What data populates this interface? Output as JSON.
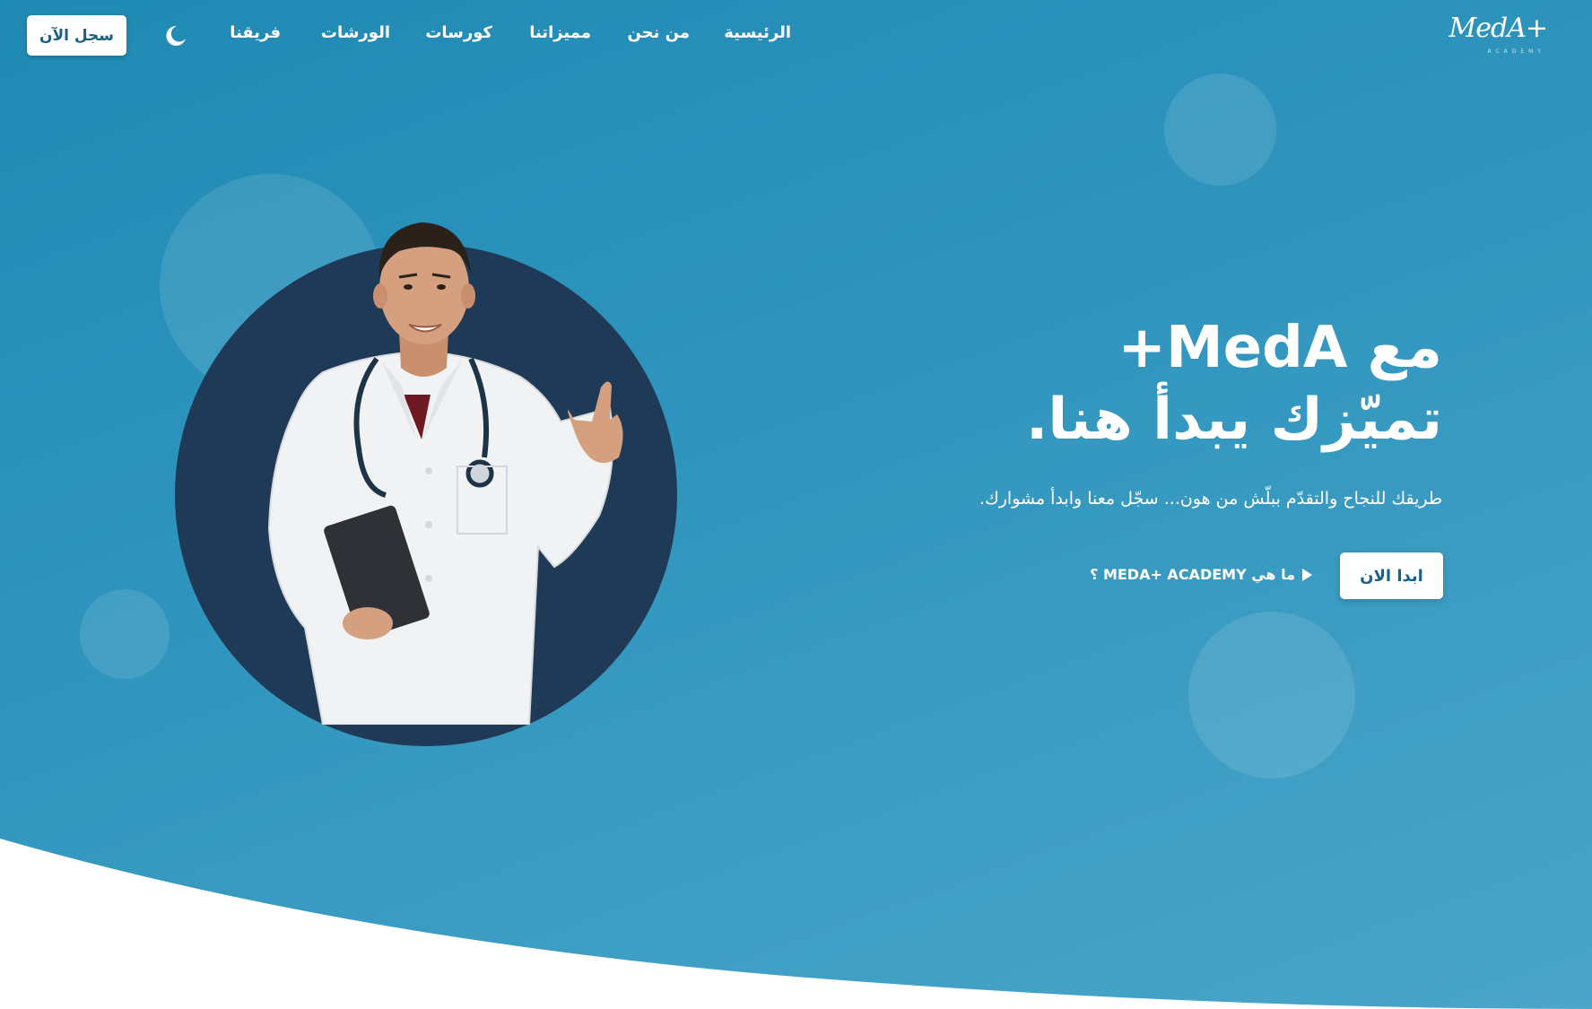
{
  "brand": {
    "logo_text": "MedA+",
    "logo_sub": "ACADEMY"
  },
  "nav": {
    "links": [
      {
        "label": "الرئيسية"
      },
      {
        "label": "من نحن"
      },
      {
        "label": "مميزاتنا"
      },
      {
        "label": "كورسات"
      },
      {
        "label": "الورشات"
      },
      {
        "label": "فريقنا"
      }
    ],
    "theme_toggle_icon": "moon-icon",
    "register_label": "سجل الآن"
  },
  "hero": {
    "title_line1": "مع MedA+",
    "title_line2": "تميّزك يبدأ هنا.",
    "subtitle": "طريقك للنجاح والتقدّم ببلّش من هون... سجّل معنا وابدأ مشوارك.",
    "start_label": "ابدا الان",
    "what_label": "ما هي MEDA+ ACADEMY ؟",
    "what_icon": "play-icon"
  },
  "colors": {
    "background": "#2a91bb",
    "circle": "#1e3a56",
    "button_text": "#1b5f82",
    "white": "#ffffff"
  }
}
